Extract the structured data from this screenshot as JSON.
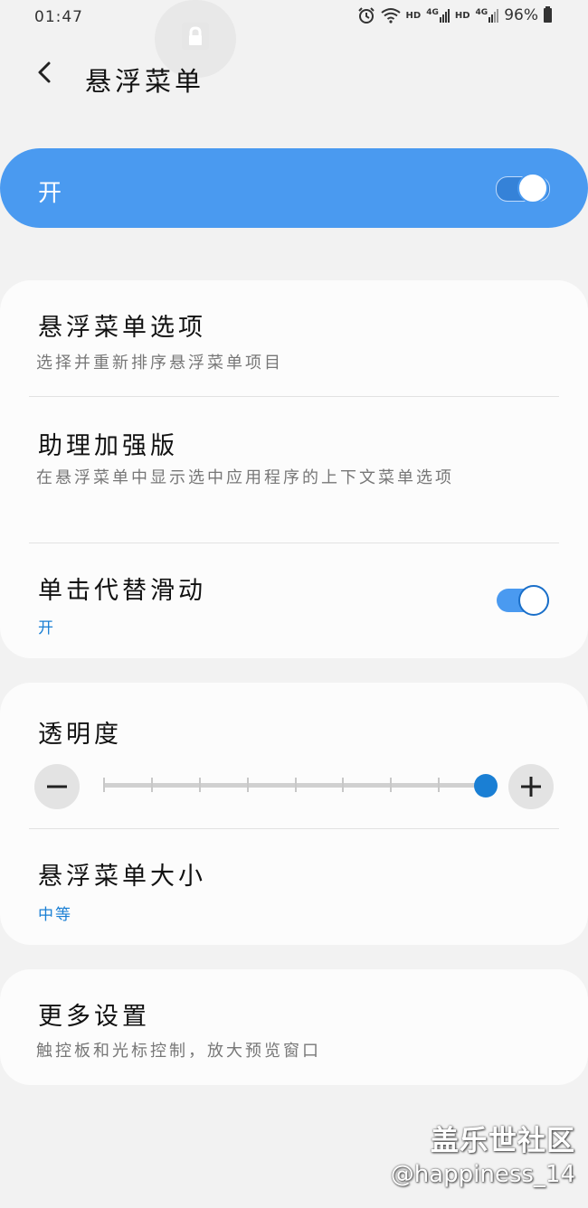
{
  "status_bar": {
    "time": "01:47",
    "hd1": "HD",
    "net1": "4G",
    "hd2": "HD",
    "net2": "4G",
    "battery": "96%",
    "icons": [
      "alarm-icon",
      "wifi-icon",
      "signal-icon",
      "battery-icon"
    ]
  },
  "header": {
    "title": "悬浮菜单",
    "back_icon": "chevron-left-icon"
  },
  "master_switch": {
    "label": "开",
    "on": true
  },
  "menu_options": {
    "title": "悬浮菜单选项",
    "subtitle": "选择并重新排序悬浮菜单项目"
  },
  "assistant_plus": {
    "title": "助理加强版",
    "subtitle": "在悬浮菜单中显示选中应用程序的上下文菜单选项"
  },
  "tap_instead_swipe": {
    "title": "单击代替滑动",
    "status": "开",
    "on": true
  },
  "transparency": {
    "title": "透明度",
    "minus_label": "−",
    "plus_label": "+",
    "level": 8,
    "max_level": 8
  },
  "menu_size": {
    "title": "悬浮菜单大小",
    "value": "中等"
  },
  "more_settings": {
    "title": "更多设置",
    "subtitle": "触控板和光标控制，放大预览窗口"
  },
  "watermark": {
    "site": "盖乐世社区",
    "user": "@happiness_14"
  },
  "colors": {
    "accent": "#4a9af0",
    "accent_dark": "#1a7fd4",
    "background": "#f2f2f2",
    "card": "#fcfcfc"
  }
}
